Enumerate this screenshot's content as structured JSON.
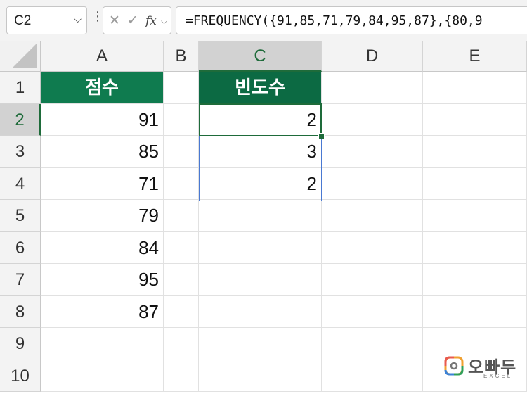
{
  "formula_bar": {
    "name_box": "C2",
    "formula": "=FREQUENCY({91,85,71,79,84,95,87},{80,9"
  },
  "columns": [
    "A",
    "B",
    "C",
    "D",
    "E"
  ],
  "rows": [
    "1",
    "2",
    "3",
    "4",
    "5",
    "6",
    "7",
    "8",
    "9",
    "10"
  ],
  "cells": {
    "A1": "점수",
    "A2": "91",
    "A3": "85",
    "A4": "71",
    "A5": "79",
    "A6": "84",
    "A7": "95",
    "A8": "87",
    "C1": "빈도수",
    "C2": "2",
    "C3": "3",
    "C4": "2"
  },
  "selection": {
    "active_cell": "C2",
    "range": "C2:C4"
  },
  "watermark": {
    "brand": "오빠두",
    "sub": "EXCEL"
  },
  "colors": {
    "header_green": "#0f7b4f",
    "select_green": "#1e6b3a",
    "range_blue": "#4a79d2"
  }
}
